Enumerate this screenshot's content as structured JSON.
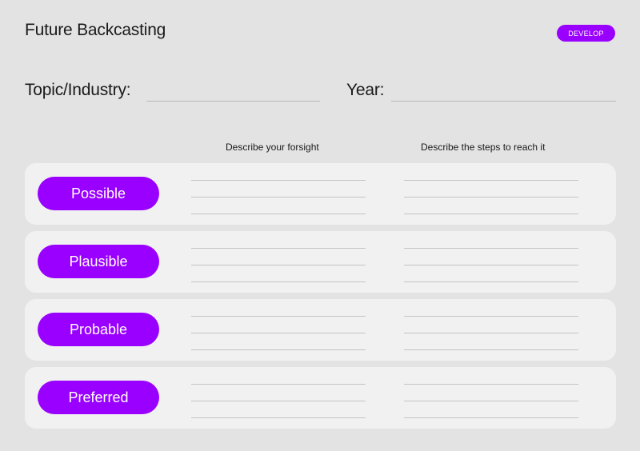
{
  "header": {
    "title": "Future Backcasting",
    "badge": "DEVELOP"
  },
  "fields": {
    "topic_label": "Topic/Industry:",
    "topic_value": "",
    "year_label": "Year:",
    "year_value": ""
  },
  "columns": {
    "foresight": "Describe your forsight",
    "steps": "Describe the steps to reach it"
  },
  "rows": [
    {
      "label": "Possible"
    },
    {
      "label": "Plausible"
    },
    {
      "label": "Probable"
    },
    {
      "label": "Preferred"
    }
  ],
  "colors": {
    "accent": "#9a00ff",
    "background": "#e3e3e3",
    "card": "#f1f1f1"
  }
}
